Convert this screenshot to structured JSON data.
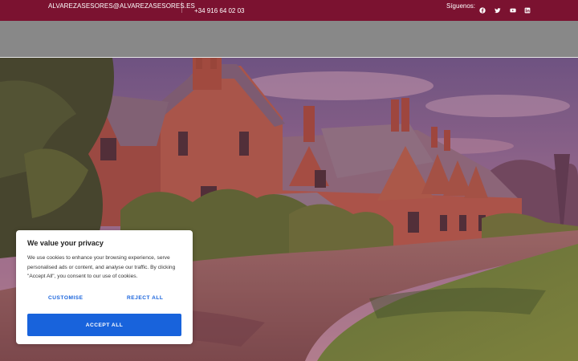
{
  "topbar": {
    "email": "ALVAREZASESORES@ALVAREZASESORES.ES",
    "phone": "+34 916 64 02 03",
    "follow_label": "Síguenos:",
    "socials": [
      "facebook-icon",
      "twitter-icon",
      "youtube-icon",
      "linkedin-icon"
    ],
    "background": "#7b1230"
  },
  "navbar": {
    "background": "#888888"
  },
  "hero": {
    "overlay_color": "#8b2040"
  },
  "cookie_banner": {
    "title": "We value your privacy",
    "body": "We use cookies to enhance your browsing experience, serve personalised ads or content, and analyse our traffic. By clicking \"Accept All\", you consent to our use of cookies.",
    "customise_label": "CUSTOMISE",
    "reject_label": "REJECT ALL",
    "accept_label": "ACCEPT ALL",
    "accent": "#1863dc"
  }
}
